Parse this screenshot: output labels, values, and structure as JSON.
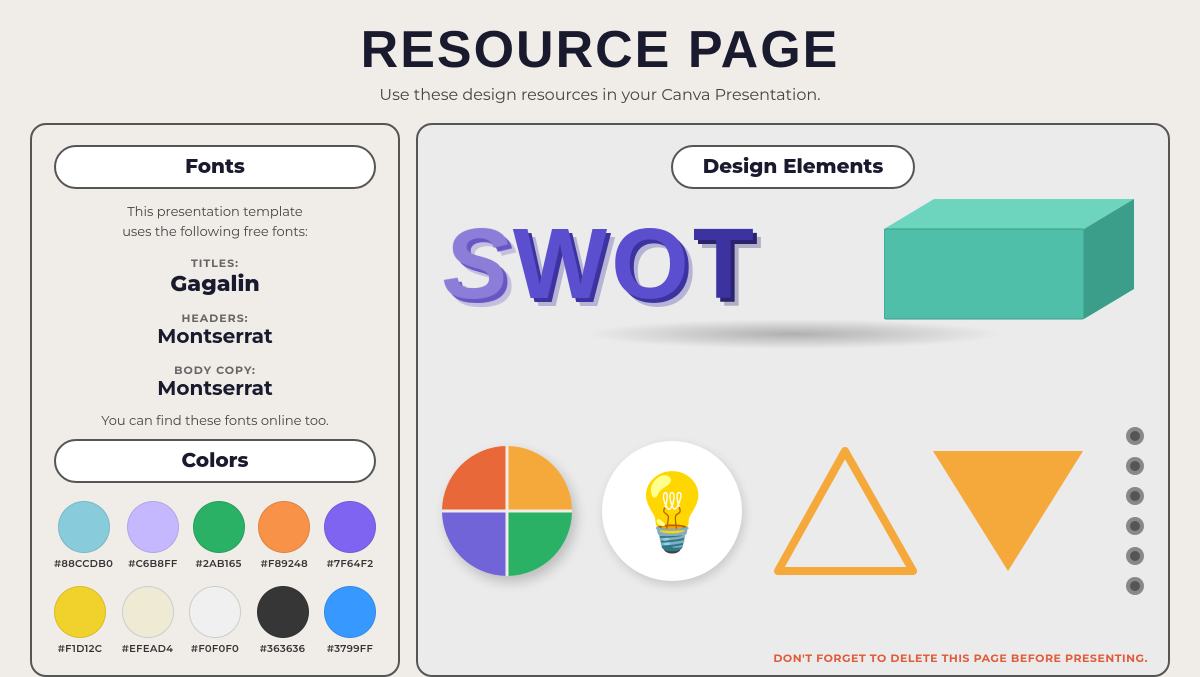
{
  "page": {
    "title": "RESOURCE PAGE",
    "subtitle": "Use these design resources in your Canva Presentation."
  },
  "left_panel": {
    "fonts_label": "Fonts",
    "fonts_description_line1": "This presentation template",
    "fonts_description_line2": "uses the following free fonts:",
    "titles_label": "TITLES:",
    "titles_font": "Gagalin",
    "headers_label": "HEADERS:",
    "headers_font": "Montserrat",
    "body_label": "BODY COPY:",
    "body_font": "Montserrat",
    "find_fonts_note": "You can find these fonts online too.",
    "colors_label": "Colors",
    "colors": [
      {
        "hex": "#88CCDB",
        "label": "#88CCDB0"
      },
      {
        "hex": "#C6B8FF",
        "label": "#C6B8FF"
      },
      {
        "hex": "#2AB165",
        "label": "#2AB165"
      },
      {
        "hex": "#F89248",
        "label": "#F89248"
      },
      {
        "hex": "#7F64F2",
        "label": "#7F64F2"
      },
      {
        "hex": "#F1D12C",
        "label": "#F1D12C"
      },
      {
        "hex": "#EFEAD4",
        "label": "#EFEAD4"
      },
      {
        "hex": "#F0F0F0",
        "label": "#F0F0F0"
      },
      {
        "hex": "#363636",
        "label": "#363636"
      },
      {
        "hex": "#3799FF",
        "label": "#3799FF"
      }
    ]
  },
  "right_panel": {
    "design_elements_label": "Design Elements",
    "swot_text": "SWOT",
    "footer_note": "DON'T FORGET TO DELETE THIS PAGE BEFORE PRESENTING."
  }
}
